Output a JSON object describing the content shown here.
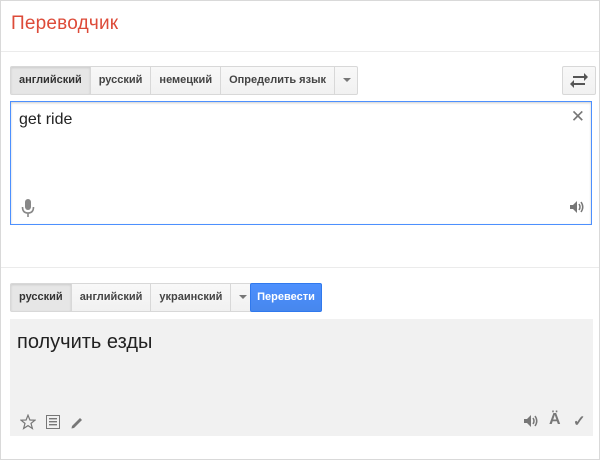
{
  "app": {
    "title": "Переводчик"
  },
  "source": {
    "languages": [
      {
        "label": "английский",
        "selected": true
      },
      {
        "label": "русский",
        "selected": false
      },
      {
        "label": "немецкий",
        "selected": false
      },
      {
        "label": "Определить язык",
        "selected": false
      }
    ],
    "text": "get ride",
    "icons": {
      "clear": "close-icon",
      "mic": "microphone-icon",
      "listen": "speaker-icon",
      "swap": "swap-languages-icon"
    }
  },
  "target": {
    "languages": [
      {
        "label": "русский",
        "selected": true
      },
      {
        "label": "английский",
        "selected": false
      },
      {
        "label": "украинский",
        "selected": false
      }
    ],
    "translate_button": "Перевести",
    "result_text": "получить езды",
    "icons": {
      "star": "star-icon",
      "list": "list-icon",
      "edit": "pencil-icon",
      "listen": "speaker-icon",
      "transliteration": "transliteration-icon",
      "check": "checkmark-icon"
    }
  },
  "colors": {
    "title": "#dd4b39",
    "accent": "#4d90fe"
  }
}
